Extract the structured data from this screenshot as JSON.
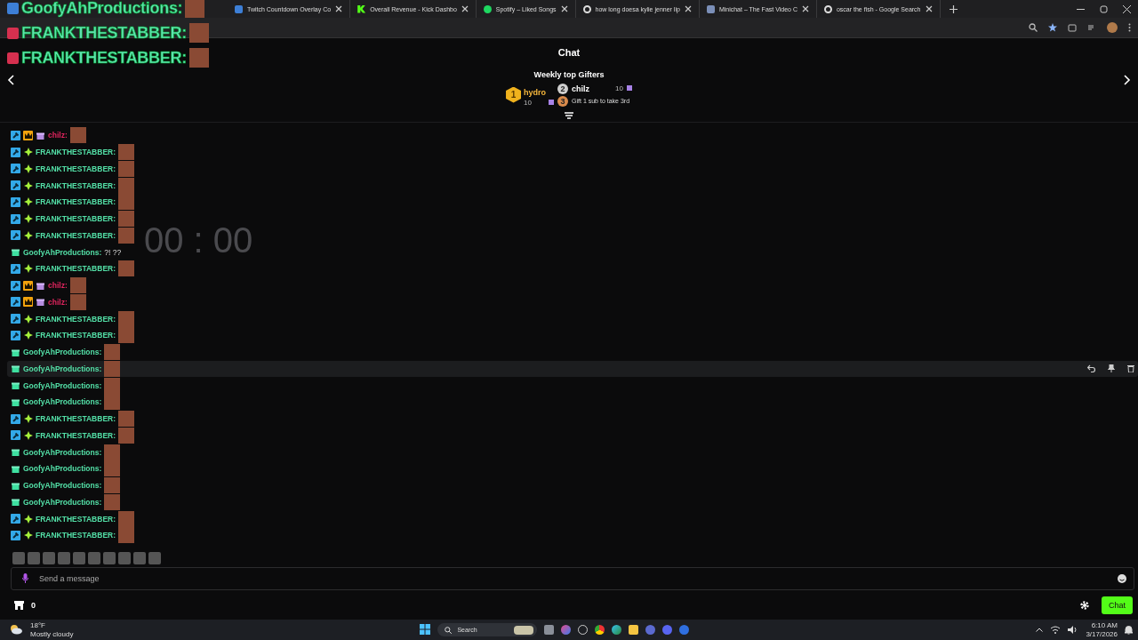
{
  "browser": {
    "tabs": [
      {
        "title": "Twitch Countdown Overlay Co",
        "selected": false
      },
      {
        "title": "Overall Revenue - Kick Dashbo",
        "selected": false
      },
      {
        "title": "Spotify – Liked Songs",
        "selected": false
      },
      {
        "title": "how long doesa kylie jenner lip",
        "selected": false
      },
      {
        "title": "Minichat – The Fast Video C",
        "selected": false
      },
      {
        "title": "oscar the fish - Google Search",
        "selected": false
      }
    ]
  },
  "overlay": {
    "messages": [
      {
        "username": "GoofyAhProductions:",
        "kind": "gift"
      },
      {
        "username": "FRANKTHESTABBER:",
        "kind": "rocket"
      },
      {
        "username": "FRANKTHESTABBER:",
        "kind": "rocket"
      }
    ]
  },
  "chat": {
    "title": "Chat",
    "gifters_title": "Weekly top Gifters",
    "gifters": [
      {
        "rank": "1",
        "name": "hydro",
        "count": "10"
      },
      {
        "rank": "2",
        "name": "chilz",
        "count": "10"
      }
    ],
    "gift_prompt": {
      "rank": "3",
      "text": "Gift 1 sub to take 3rd"
    },
    "timer": "00 : 00",
    "messages": [
      {
        "username": "chilz:",
        "color": "#e0245e",
        "badges": [
          {
            "kind": "moderator"
          },
          {
            "kind": "crown"
          },
          {
            "kind": "gift"
          }
        ],
        "highlighted": false
      },
      {
        "username": "FRANKTHESTABBER:",
        "color": "#53e0a7",
        "badges": [
          {
            "kind": "moderator"
          },
          {
            "kind": "diamond"
          }
        ],
        "highlighted": false
      },
      {
        "username": "FRANKTHESTABBER:",
        "color": "#53e0a7",
        "badges": [
          {
            "kind": "moderator"
          },
          {
            "kind": "diamond"
          }
        ],
        "highlighted": false
      },
      {
        "username": "FRANKTHESTABBER:",
        "color": "#53e0a7",
        "badges": [
          {
            "kind": "moderator"
          },
          {
            "kind": "diamond"
          }
        ],
        "highlighted": false
      },
      {
        "username": "FRANKTHESTABBER:",
        "color": "#53e0a7",
        "badges": [
          {
            "kind": "moderator"
          },
          {
            "kind": "diamond"
          }
        ],
        "highlighted": false
      },
      {
        "username": "FRANKTHESTABBER:",
        "color": "#53e0a7",
        "badges": [
          {
            "kind": "moderator"
          },
          {
            "kind": "diamond"
          }
        ],
        "highlighted": false
      },
      {
        "username": "FRANKTHESTABBER:",
        "color": "#53e0a7",
        "badges": [
          {
            "kind": "moderator"
          },
          {
            "kind": "diamond"
          }
        ],
        "highlighted": false
      },
      {
        "username": "GoofyAhProductions:",
        "color": "#53e0a7",
        "badges": [
          {
            "kind": "gift"
          }
        ],
        "text": "?! ??",
        "highlighted": false
      },
      {
        "username": "FRANKTHESTABBER:",
        "color": "#53e0a7",
        "badges": [
          {
            "kind": "moderator"
          },
          {
            "kind": "diamond"
          }
        ],
        "highlighted": false
      },
      {
        "username": "chilz:",
        "color": "#e0245e",
        "badges": [
          {
            "kind": "moderator"
          },
          {
            "kind": "crown"
          },
          {
            "kind": "gift"
          }
        ],
        "highlighted": false
      },
      {
        "username": "chilz:",
        "color": "#e0245e",
        "badges": [
          {
            "kind": "moderator"
          },
          {
            "kind": "crown"
          },
          {
            "kind": "gift"
          }
        ],
        "highlighted": false
      },
      {
        "username": "FRANKTHESTABBER:",
        "color": "#53e0a7",
        "badges": [
          {
            "kind": "moderator"
          },
          {
            "kind": "diamond"
          }
        ],
        "highlighted": false
      },
      {
        "username": "FRANKTHESTABBER:",
        "color": "#53e0a7",
        "badges": [
          {
            "kind": "moderator"
          },
          {
            "kind": "diamond"
          }
        ],
        "highlighted": false
      },
      {
        "username": "GoofyAhProductions:",
        "color": "#53e0a7",
        "badges": [
          {
            "kind": "gift"
          }
        ],
        "highlighted": false
      },
      {
        "username": "GoofyAhProductions:",
        "color": "#53e0a7",
        "badges": [
          {
            "kind": "gift"
          }
        ],
        "highlighted": true
      },
      {
        "username": "GoofyAhProductions:",
        "color": "#53e0a7",
        "badges": [
          {
            "kind": "gift"
          }
        ],
        "highlighted": false
      },
      {
        "username": "GoofyAhProductions:",
        "color": "#53e0a7",
        "badges": [
          {
            "kind": "gift"
          }
        ],
        "highlighted": false
      },
      {
        "username": "FRANKTHESTABBER:",
        "color": "#53e0a7",
        "badges": [
          {
            "kind": "moderator"
          },
          {
            "kind": "diamond"
          }
        ],
        "highlighted": false
      },
      {
        "username": "FRANKTHESTABBER:",
        "color": "#53e0a7",
        "badges": [
          {
            "kind": "moderator"
          },
          {
            "kind": "diamond"
          }
        ],
        "highlighted": false
      },
      {
        "username": "GoofyAhProductions:",
        "color": "#53e0a7",
        "badges": [
          {
            "kind": "gift"
          }
        ],
        "highlighted": false
      },
      {
        "username": "GoofyAhProductions:",
        "color": "#53e0a7",
        "badges": [
          {
            "kind": "gift"
          }
        ],
        "highlighted": false
      },
      {
        "username": "GoofyAhProductions:",
        "color": "#53e0a7",
        "badges": [
          {
            "kind": "gift"
          }
        ],
        "highlighted": false
      },
      {
        "username": "GoofyAhProductions:",
        "color": "#53e0a7",
        "badges": [
          {
            "kind": "gift"
          }
        ],
        "highlighted": false
      },
      {
        "username": "FRANKTHESTABBER:",
        "color": "#53e0a7",
        "badges": [
          {
            "kind": "moderator"
          },
          {
            "kind": "diamond"
          }
        ],
        "highlighted": false
      },
      {
        "username": "FRANKTHESTABBER:",
        "color": "#53e0a7",
        "badges": [
          {
            "kind": "moderator"
          },
          {
            "kind": "diamond"
          }
        ],
        "highlighted": false
      }
    ],
    "input": {
      "placeholder": "Send a message"
    },
    "points": "0",
    "send_button": "Chat"
  },
  "taskbar": {
    "temperature": "18°F",
    "weather": "Mostly cloudy",
    "search": "Search",
    "time": "6:10 AM",
    "date": "3/17/2026"
  }
}
